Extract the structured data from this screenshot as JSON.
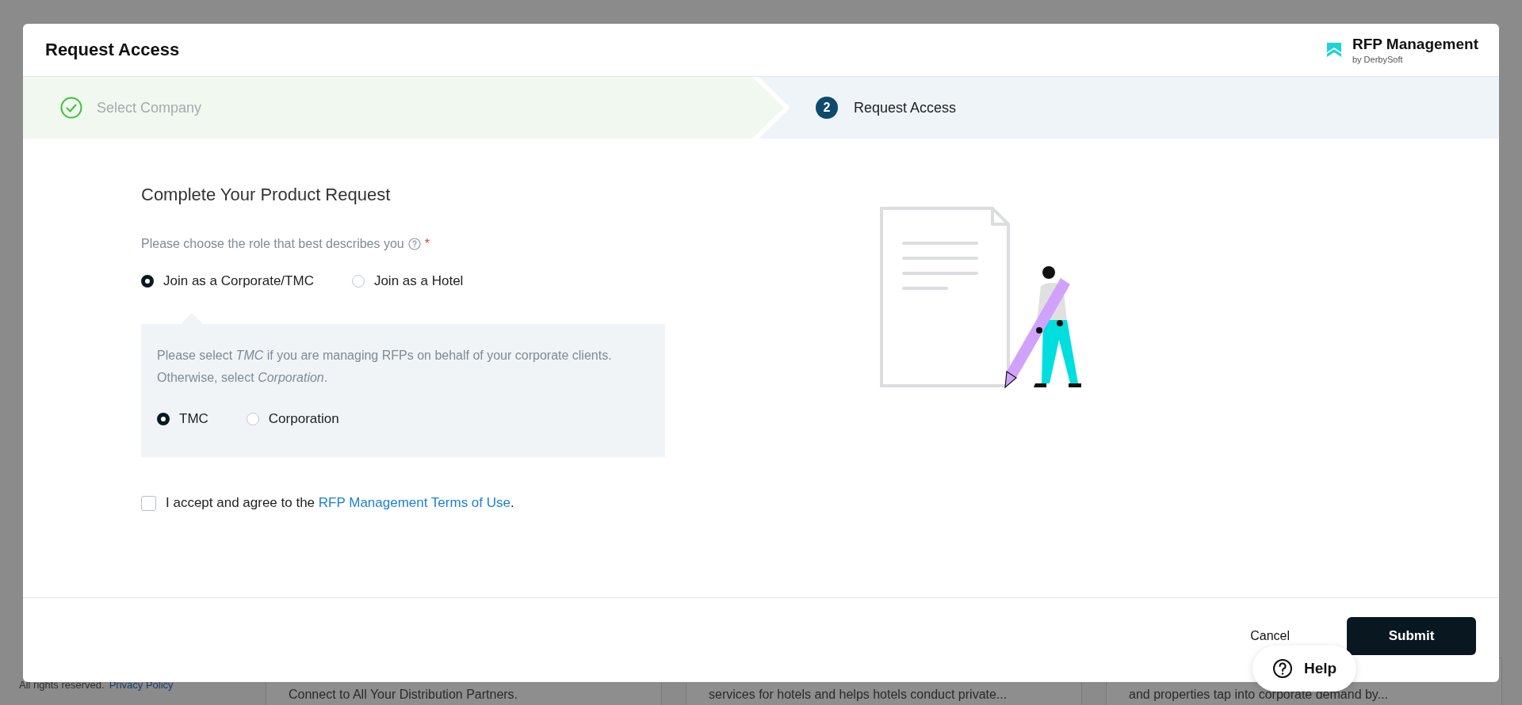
{
  "background": {
    "footer": {
      "copyright": "All rights reserved.",
      "link": "Privacy Policy"
    },
    "cards": [
      {
        "text": "Connect to All Your Distribution Partners."
      },
      {
        "text": "services for hotels and helps hotels conduct private..."
      },
      {
        "text": "and properties tap into corporate demand by..."
      }
    ]
  },
  "modal": {
    "title": "Request Access",
    "brand": {
      "name": "RFP Management",
      "byline": "by DerbySoft"
    },
    "steps": [
      {
        "label": "Select Company",
        "completed": true,
        "selected": false
      },
      {
        "number": "2",
        "label": "Request Access",
        "completed": false,
        "selected": true
      }
    ],
    "form": {
      "heading": "Complete Your Product Request",
      "role_label": "Please choose the role that best describes you",
      "required": "*",
      "roles": [
        {
          "label": "Join as a Corporate/TMC",
          "selected": true
        },
        {
          "label": "Join as a Hotel",
          "selected": false
        }
      ],
      "hint": "Please select *TMC* if you are managing RFPs on behalf of your corporate clients. Otherwise, select *Corporation*.",
      "sub_roles": [
        {
          "label": "TMC",
          "selected": true
        },
        {
          "label": "Corporation",
          "selected": false
        }
      ],
      "terms": {
        "checked": false,
        "text": "I accept and agree to the ",
        "link": "RFP Management Terms of Use",
        "end": "."
      }
    },
    "footer": {
      "cancel": "Cancel",
      "submit": "Submit"
    }
  },
  "help": {
    "label": "Help"
  }
}
